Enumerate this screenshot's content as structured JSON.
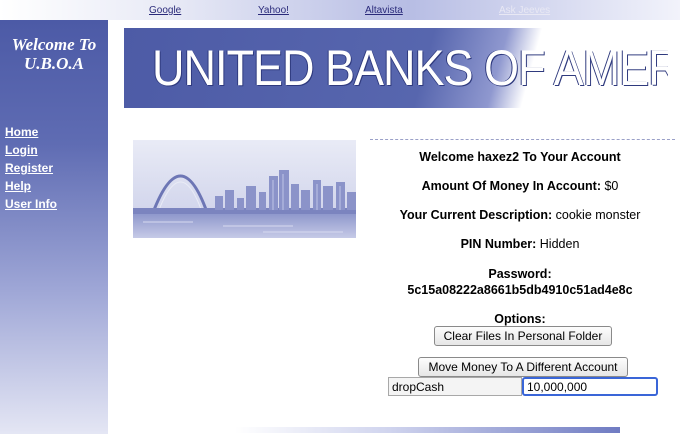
{
  "top_links": {
    "google": "Google",
    "yahoo": "Yahoo!",
    "altavista": "Altavista",
    "ask_jeeves": "Ask Jeeves"
  },
  "sidebar": {
    "welcome_line1": "Welcome To",
    "welcome_line2": "U.B.O.A",
    "nav": [
      "Home",
      "Login",
      "Register",
      "Help",
      "User Info"
    ]
  },
  "banner": {
    "title": "UNITED BANKS OF AMERICA"
  },
  "account": {
    "welcome_prefix": "Welcome",
    "username": "haxez2",
    "welcome_suffix": "To Your Account",
    "money_label": "Amount Of Money In Account:",
    "money_value": "$0",
    "description_label": "Your Current Description:",
    "description_value": "cookie monster",
    "pin_label": "PIN Number:",
    "pin_value": "Hidden",
    "password_label": "Password:",
    "password_value": "5c15a08222a8661b5db4910c51ad4e8c",
    "options_label": "Options:"
  },
  "actions": {
    "clear_files_label": "Clear Files In Personal Folder",
    "move_money_label": "Move Money To A Different Account",
    "action_field_value": "dropCash",
    "amount_field_value": "10,000,000"
  },
  "colors": {
    "sidebar_blue": "#4c5aa6",
    "banner_blue": "#4d5ba6",
    "input_focus": "#3a66d8"
  }
}
